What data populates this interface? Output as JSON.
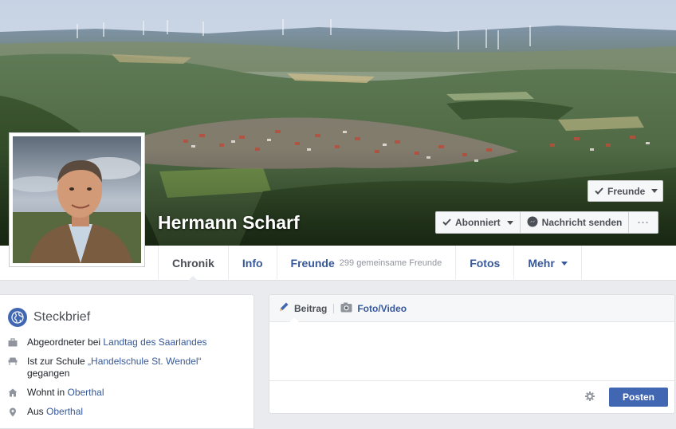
{
  "profile": {
    "name": "Hermann Scharf"
  },
  "header_buttons": {
    "friends": "Freunde",
    "subscribed": "Abonniert",
    "message": "Nachricht senden",
    "more": "···"
  },
  "nav": {
    "tabs": [
      {
        "label": "Chronik",
        "active": true
      },
      {
        "label": "Info"
      },
      {
        "label": "Freunde",
        "sub": "299 gemeinsame Freunde"
      },
      {
        "label": "Fotos"
      },
      {
        "label": "Mehr"
      }
    ]
  },
  "intro": {
    "title": "Steckbrief",
    "items": [
      {
        "icon": "briefcase-icon",
        "pre": "Abgeordneter bei ",
        "link": "Landtag des Saarlandes",
        "post": ""
      },
      {
        "icon": "school-icon",
        "pre": "Ist zur Schule ",
        "link": "„Handelschule St. Wendel“",
        "post": " gegangen"
      },
      {
        "icon": "home-icon",
        "pre": "Wohnt in ",
        "link": "Oberthal",
        "post": ""
      },
      {
        "icon": "location-pin-icon",
        "pre": "Aus ",
        "link": "Oberthal",
        "post": ""
      }
    ]
  },
  "composer": {
    "tab_post": "Beitrag",
    "tab_photo": "Foto/Video",
    "post_button": "Posten"
  },
  "colors": {
    "brand_blue": "#4267b2",
    "link_blue": "#365899",
    "page_bg": "#e9ebee"
  }
}
